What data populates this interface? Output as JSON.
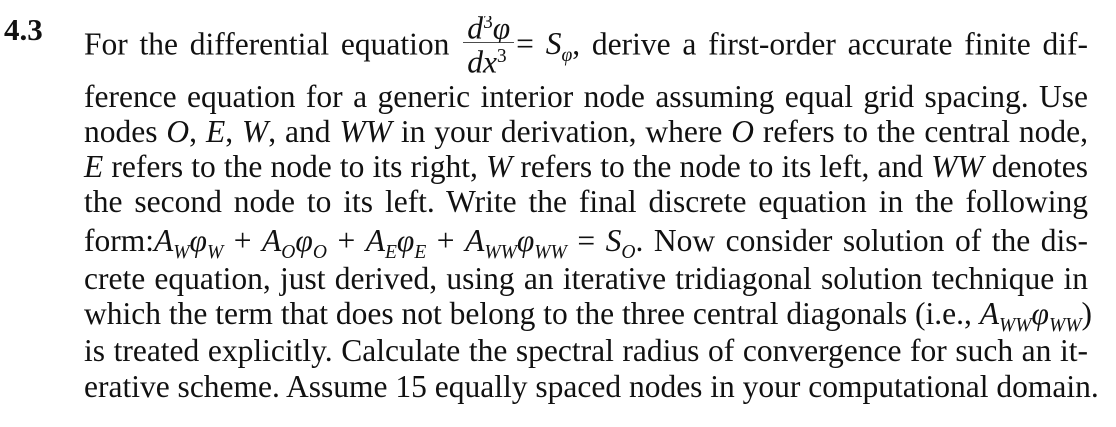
{
  "problem_number": "4.3",
  "lines": [
    "ference equation for a generic interior node assuming equal grid spacing. Use",
    "nodes O, E, W, and WW in your derivation, where O refers to the central node,",
    "E refers to the node to its right, W refers to the node to its left, and WW denotes",
    "the second node to its left. Write the final discrete equation in the following",
    "form: A_W φ_W + A_O φ_O + A_E φ_E + A_WW φ_WW = S_O. Now consider solution of the dis-",
    "crete equation, just derived, using an iterative tridiagonal solution technique in",
    "which the term that does not belong to the three central diagonals (i.e., A_WW φ_WW)",
    "is treated explicitly. Calculate the spectral radius of convergence for such an it-",
    "erative scheme. Assume 15 equally spaced nodes in your computational domain."
  ],
  "line1": {
    "before": "For the differential equation",
    "equation_numerator": "d³φ",
    "equation_denominator": "dx³",
    "equation_rhs": "= S",
    "rhs_subscript": "φ",
    "after": ", derive a first-order accurate finite dif-"
  },
  "form_equation": {
    "prefix": "form:",
    "suffix": ". Now consider solution of the dis-"
  },
  "explicit_term": "(i.e., ",
  "explicit_term_close": ")"
}
